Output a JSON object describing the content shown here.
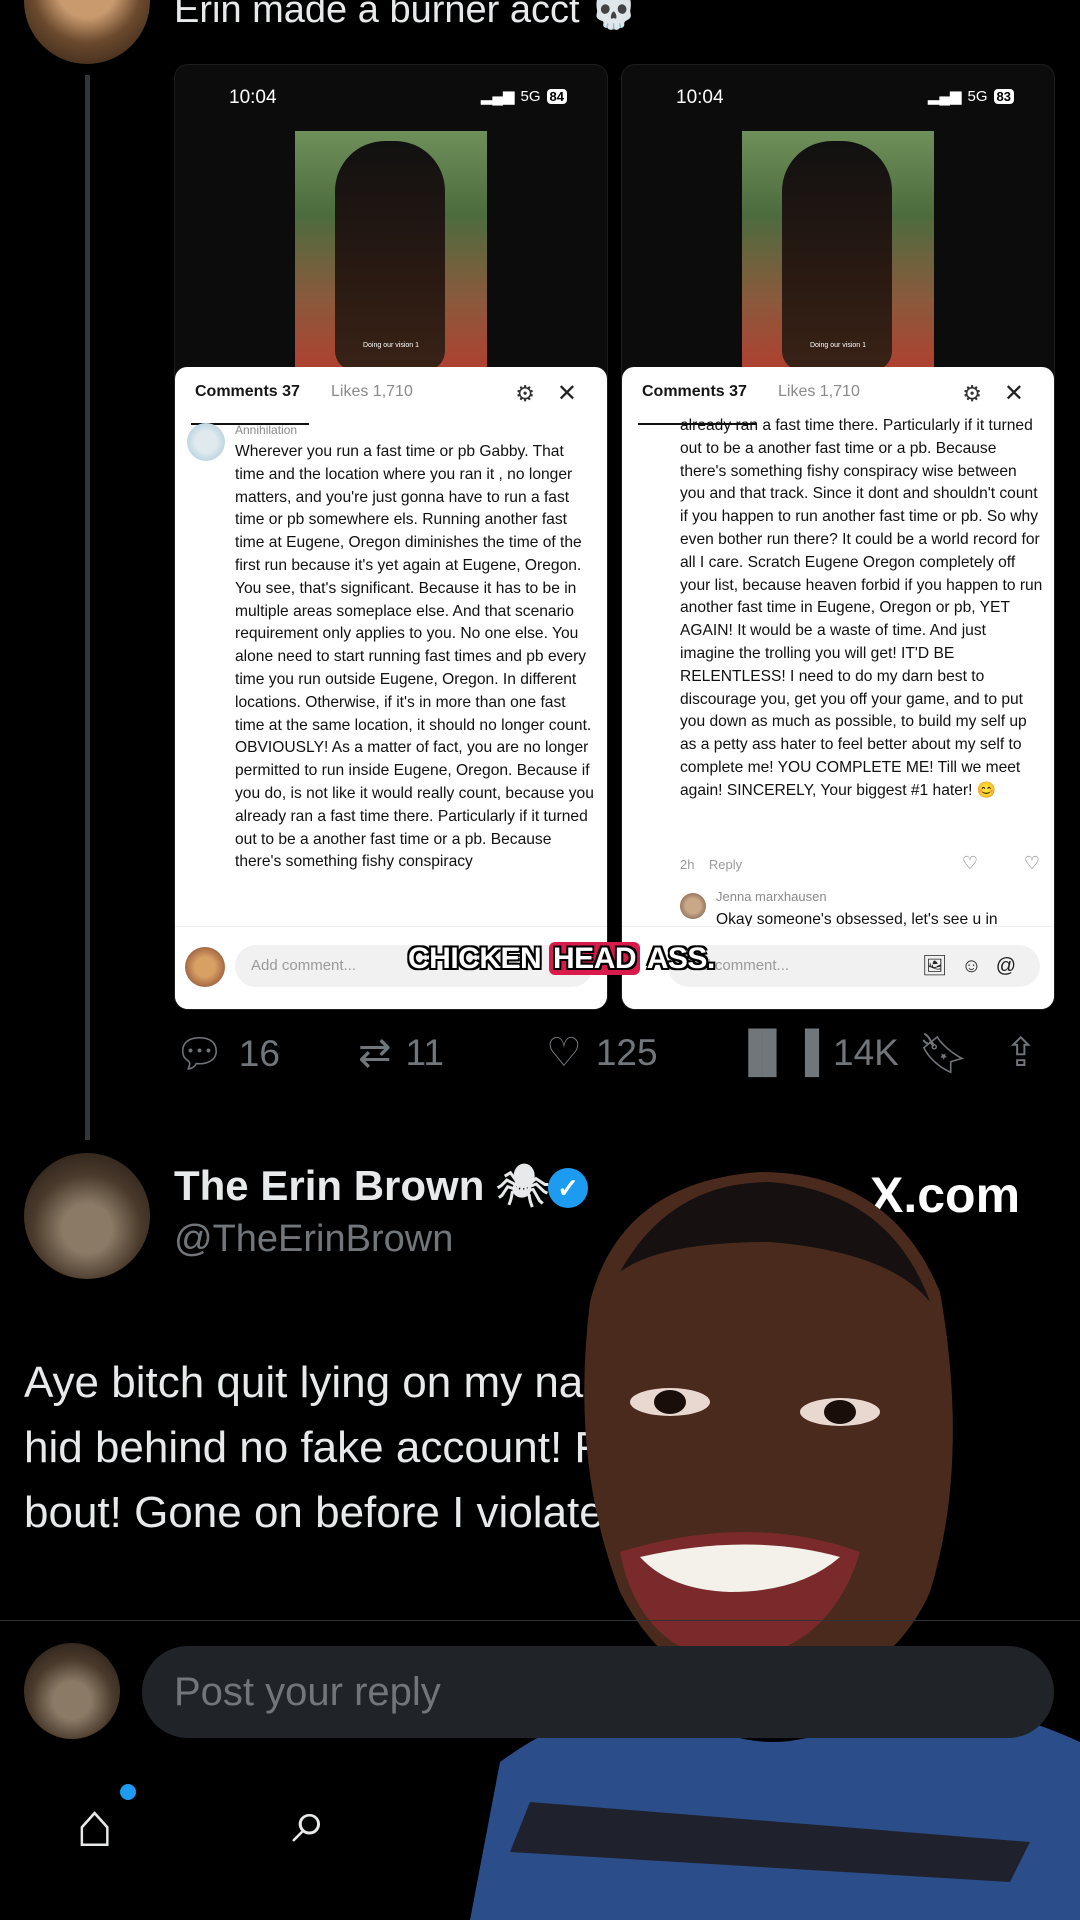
{
  "top_tweet": {
    "text": "Erin made a burner acct 💀"
  },
  "screenshot_left": {
    "time": "10:04",
    "network": "5G",
    "battery": "84",
    "video_caption": "Doing our vision 1",
    "tab_comments": "Comments 37",
    "tab_likes": "Likes 1,710",
    "comment_user": "Annihilation",
    "comment_text": "Wherever you run a fast time or pb Gabby. That time and the location where you ran it , no longer matters, and you're just gonna have to run a fast time or pb somewhere els. Running another fast time at Eugene, Oregon diminishes the time of the first run because it's yet again at Eugene, Oregon. You see, that's significant. Because it has to be in multiple areas someplace else. And that scenario requirement only applies to you. No one else. You alone need to start running fast times and pb every time you run outside Eugene, Oregon. In different locations. Otherwise, if it's in more than one fast time at the same location, it should no longer count. OBVIOUSLY! As a matter of fact, you are no longer permitted to run inside Eugene, Oregon. Because if you do, is not like it would really count, because you already ran a fast time there. Particularly if it turned out to be a another fast time or a pb. Because there's something fishy conspiracy",
    "add_comment": "Add comment..."
  },
  "screenshot_right": {
    "time": "10:04",
    "network": "5G",
    "battery": "83",
    "video_caption": "Doing our vision 1",
    "tab_comments": "Comments 37",
    "tab_likes": "Likes 1,710",
    "comment_text": "already ran a fast time there. Particularly if it turned out to be a another fast time or a pb. Because there's something fishy conspiracy wise between you and that track. Since it dont and shouldn't count if you happen to run another fast time or pb. So why even bother run there? It could be a world record for all I care. Scratch Eugene Oregon completely off your list, because heaven forbid if you happen to run another fast time in Eugene, Oregon or pb, YET AGAIN! It would be a waste of time. And just imagine the trolling you will get! IT'D BE RELENTLESS! I need to do my darn best to discourage you, get you off your game, and to put you down as much as possible, to build my self up as a petty ass hater to feel better about my self to complete me! YOU COMPLETE ME! Till we meet again! SINCERELY, Your biggest #1 hater! 😊",
    "meta_time": "2h",
    "meta_reply": "Reply",
    "reply_user": "Jenna marxhausen",
    "reply_text": "Okay someone's obsessed, let's see u in",
    "add_comment": "Add comment..."
  },
  "video_caption": {
    "pre": "CHICKEN ",
    "highlight": "HEAD",
    "post": " ASS."
  },
  "actions": {
    "replies": "16",
    "reposts": "11",
    "likes": "125",
    "views": "14K"
  },
  "reply_tweet": {
    "name": "The Erin Brown",
    "name_emoji": "🕷",
    "handle": "@TheErinBrown",
    "watermark": "X.com",
    "line1": "Aye bitch quit lying on my nam",
    "line2": "hid behind no fake account! F",
    "line3": "bout! Gone on before I violate"
  },
  "compose": {
    "placeholder": "Post your reply"
  },
  "colors": {
    "background": "#000000",
    "accent": "#1d9bf0",
    "caption_highlight": "#d81b4a"
  }
}
